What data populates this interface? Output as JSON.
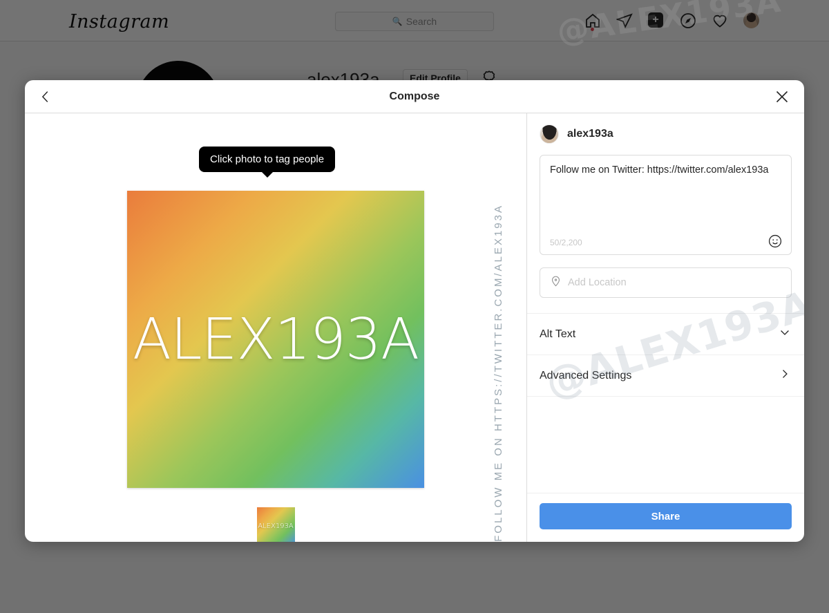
{
  "background": {
    "logo": "Instagram",
    "search": {
      "placeholder": "Search",
      "icon": "search-icon"
    },
    "nav_icons": [
      "home-icon",
      "direct-message-icon",
      "new-post-icon",
      "explore-icon",
      "activity-heart-icon",
      "profile-avatar-icon"
    ],
    "new_post_glyph": "+",
    "profile": {
      "username": "alex193a",
      "edit_profile_label": "Edit Profile",
      "settings_icon": "gear-icon"
    },
    "watermark": "@ALEX193A"
  },
  "modal": {
    "title": "Compose",
    "back_icon": "chevron-left-icon",
    "close_icon": "close-icon",
    "tooltip": "Click photo to tag people",
    "photo": {
      "caption_overlay": "ALEX193A",
      "thumbnail_overlay": "ALEX193A",
      "gradient": {
        "top_left": "#ea7c3c",
        "top_right": "#e3c74f",
        "bottom_left": "#72c05e",
        "bottom_right": "#4a90e2"
      }
    },
    "vertical_promo": "FOLLOW ME ON HTTPS://TWITTER.COM/ALEX193A",
    "watermark": "@ALEX193A",
    "form": {
      "username": "alex193a",
      "avatar_icon": "user-avatar",
      "caption_value": "Follow me on Twitter: https://twitter.com/alex193a",
      "char_count": "50/2,200",
      "emoji_icon": "emoji-smiley-icon",
      "location_placeholder": "Add Location",
      "location_icon": "location-pin-icon",
      "alt_text_label": "Alt Text",
      "alt_text_icon": "chevron-down-icon",
      "advanced_settings_label": "Advanced Settings",
      "advanced_settings_icon": "chevron-right-icon",
      "share_label": "Share",
      "share_color": "#4a90e8"
    }
  }
}
